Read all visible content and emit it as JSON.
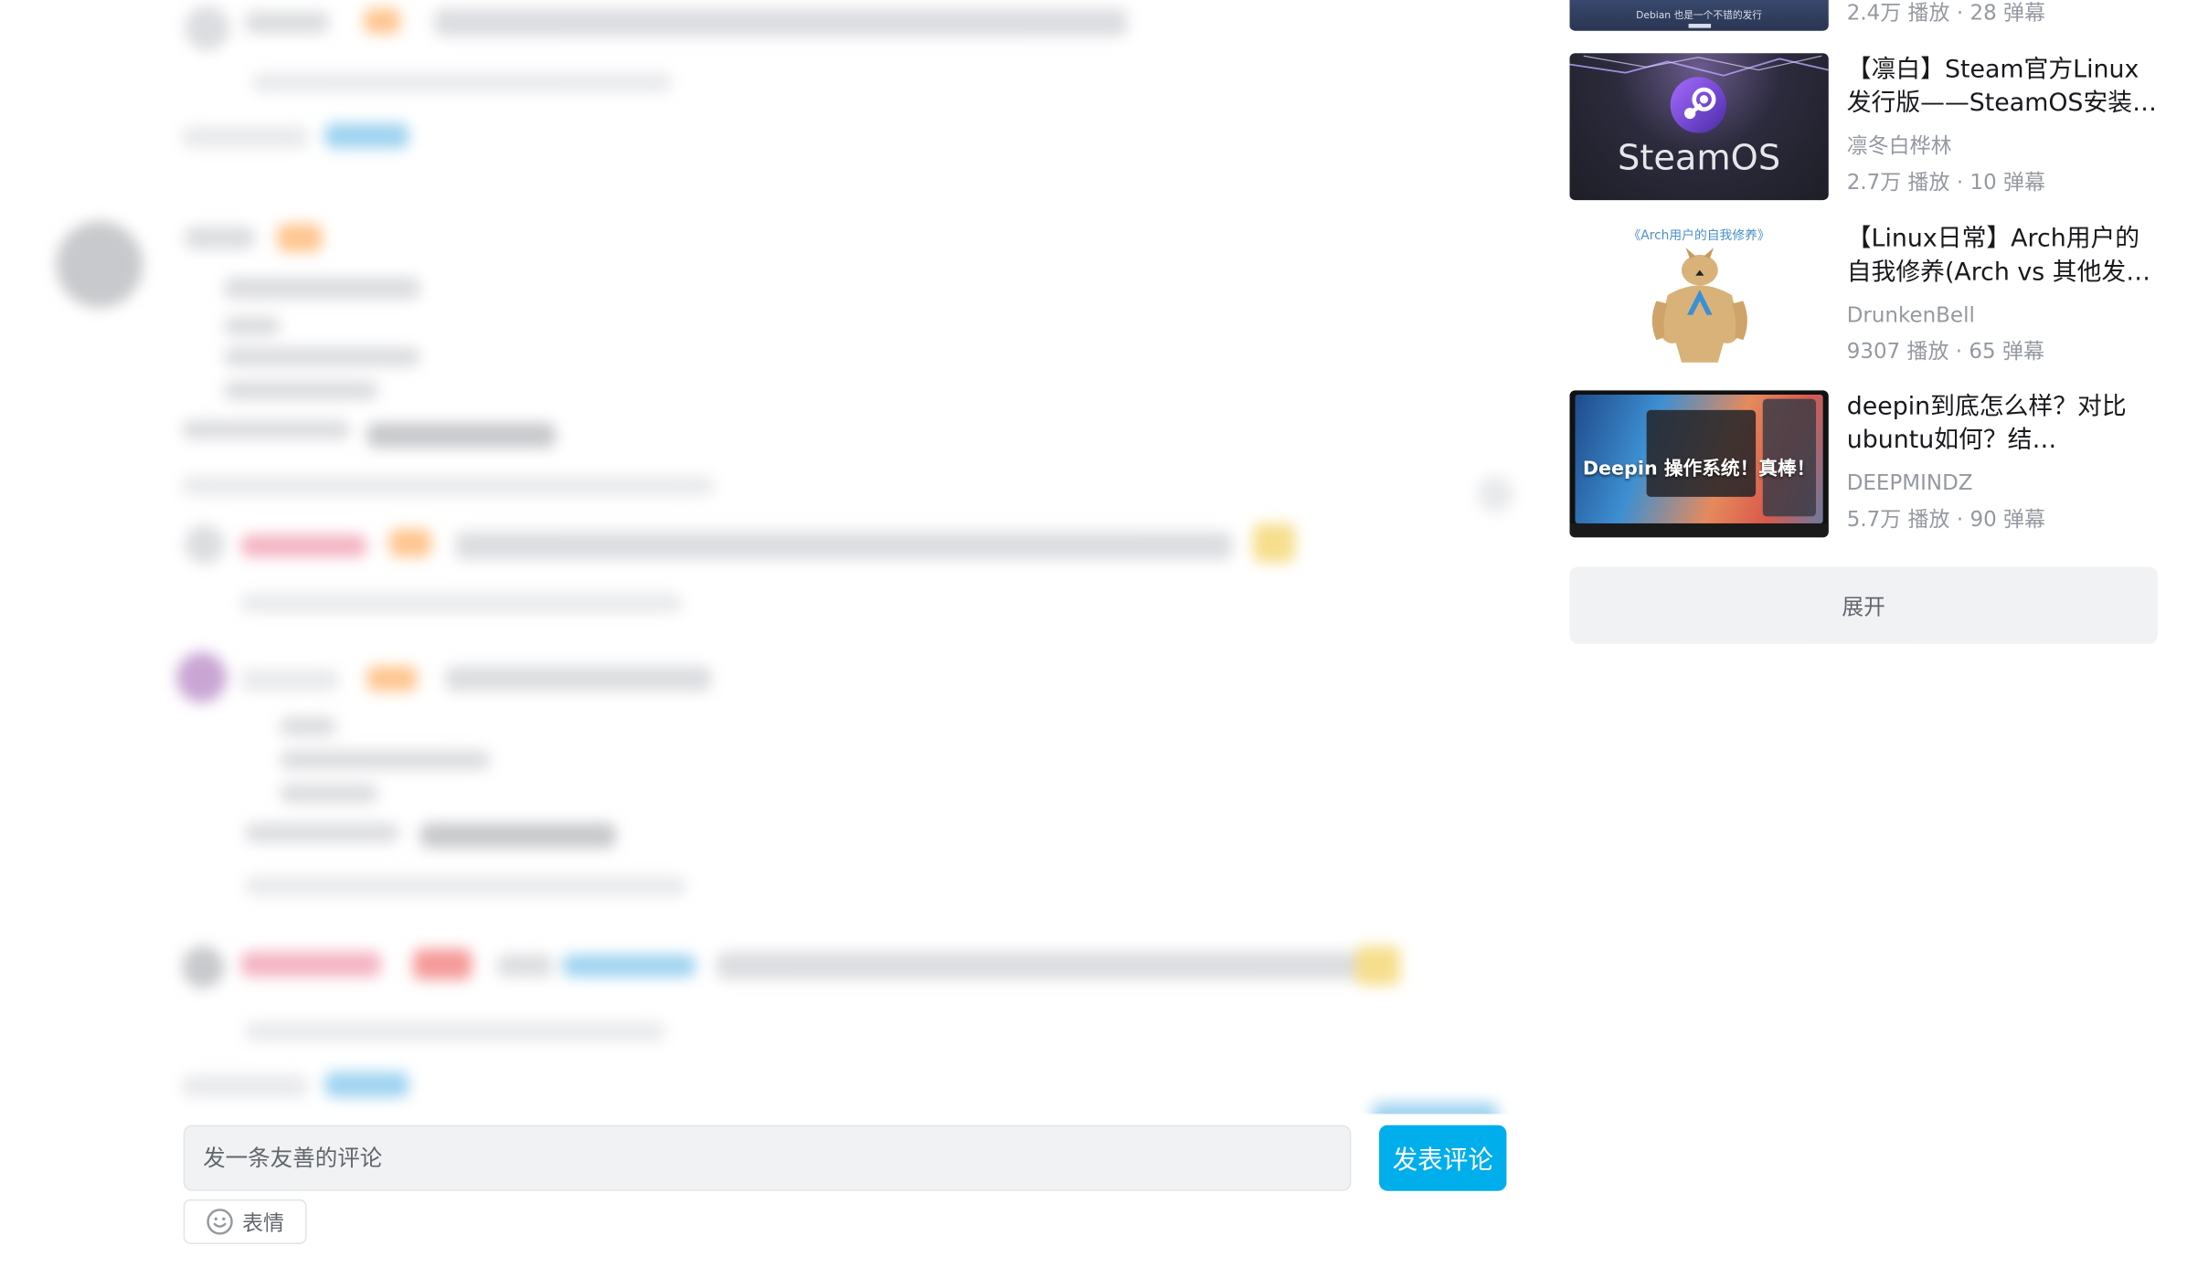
{
  "recommendations": [
    {
      "title": "",
      "author": "",
      "plays": "2.4万 播放",
      "danmaku": "28 弹幕",
      "thumb_text": "Debian 也是一个不错的发行"
    },
    {
      "title": "【凛白】Steam官方Linux发行版——SteamOS安装教程",
      "author": "凛冬白桦林",
      "plays": "2.7万 播放",
      "danmaku": "10 弹幕",
      "thumb_text": "SteamOS"
    },
    {
      "title": "【Linux日常】Arch用户的自我修养(Arch vs 其他发行版)",
      "author": "DrunkenBell",
      "plays": "9307 播放",
      "danmaku": "65 弹幕",
      "thumb_text": "《Arch用户的自我修养》"
    },
    {
      "title": "deepin到底怎么样？对比ubuntu如何？结论:deepin...",
      "author": "DEEPMINDZ",
      "plays": "5.7万 播放",
      "danmaku": "90 弹幕",
      "thumb_text": "Deepin 操作系统！真棒！"
    }
  ],
  "expand_label": "展开",
  "comment_box": {
    "placeholder": "发一条友善的评论",
    "submit_label": "发表评论",
    "emoji_label": "表情"
  },
  "colors": {
    "accent": "#00aeec",
    "secondary_text": "#9499a0"
  }
}
